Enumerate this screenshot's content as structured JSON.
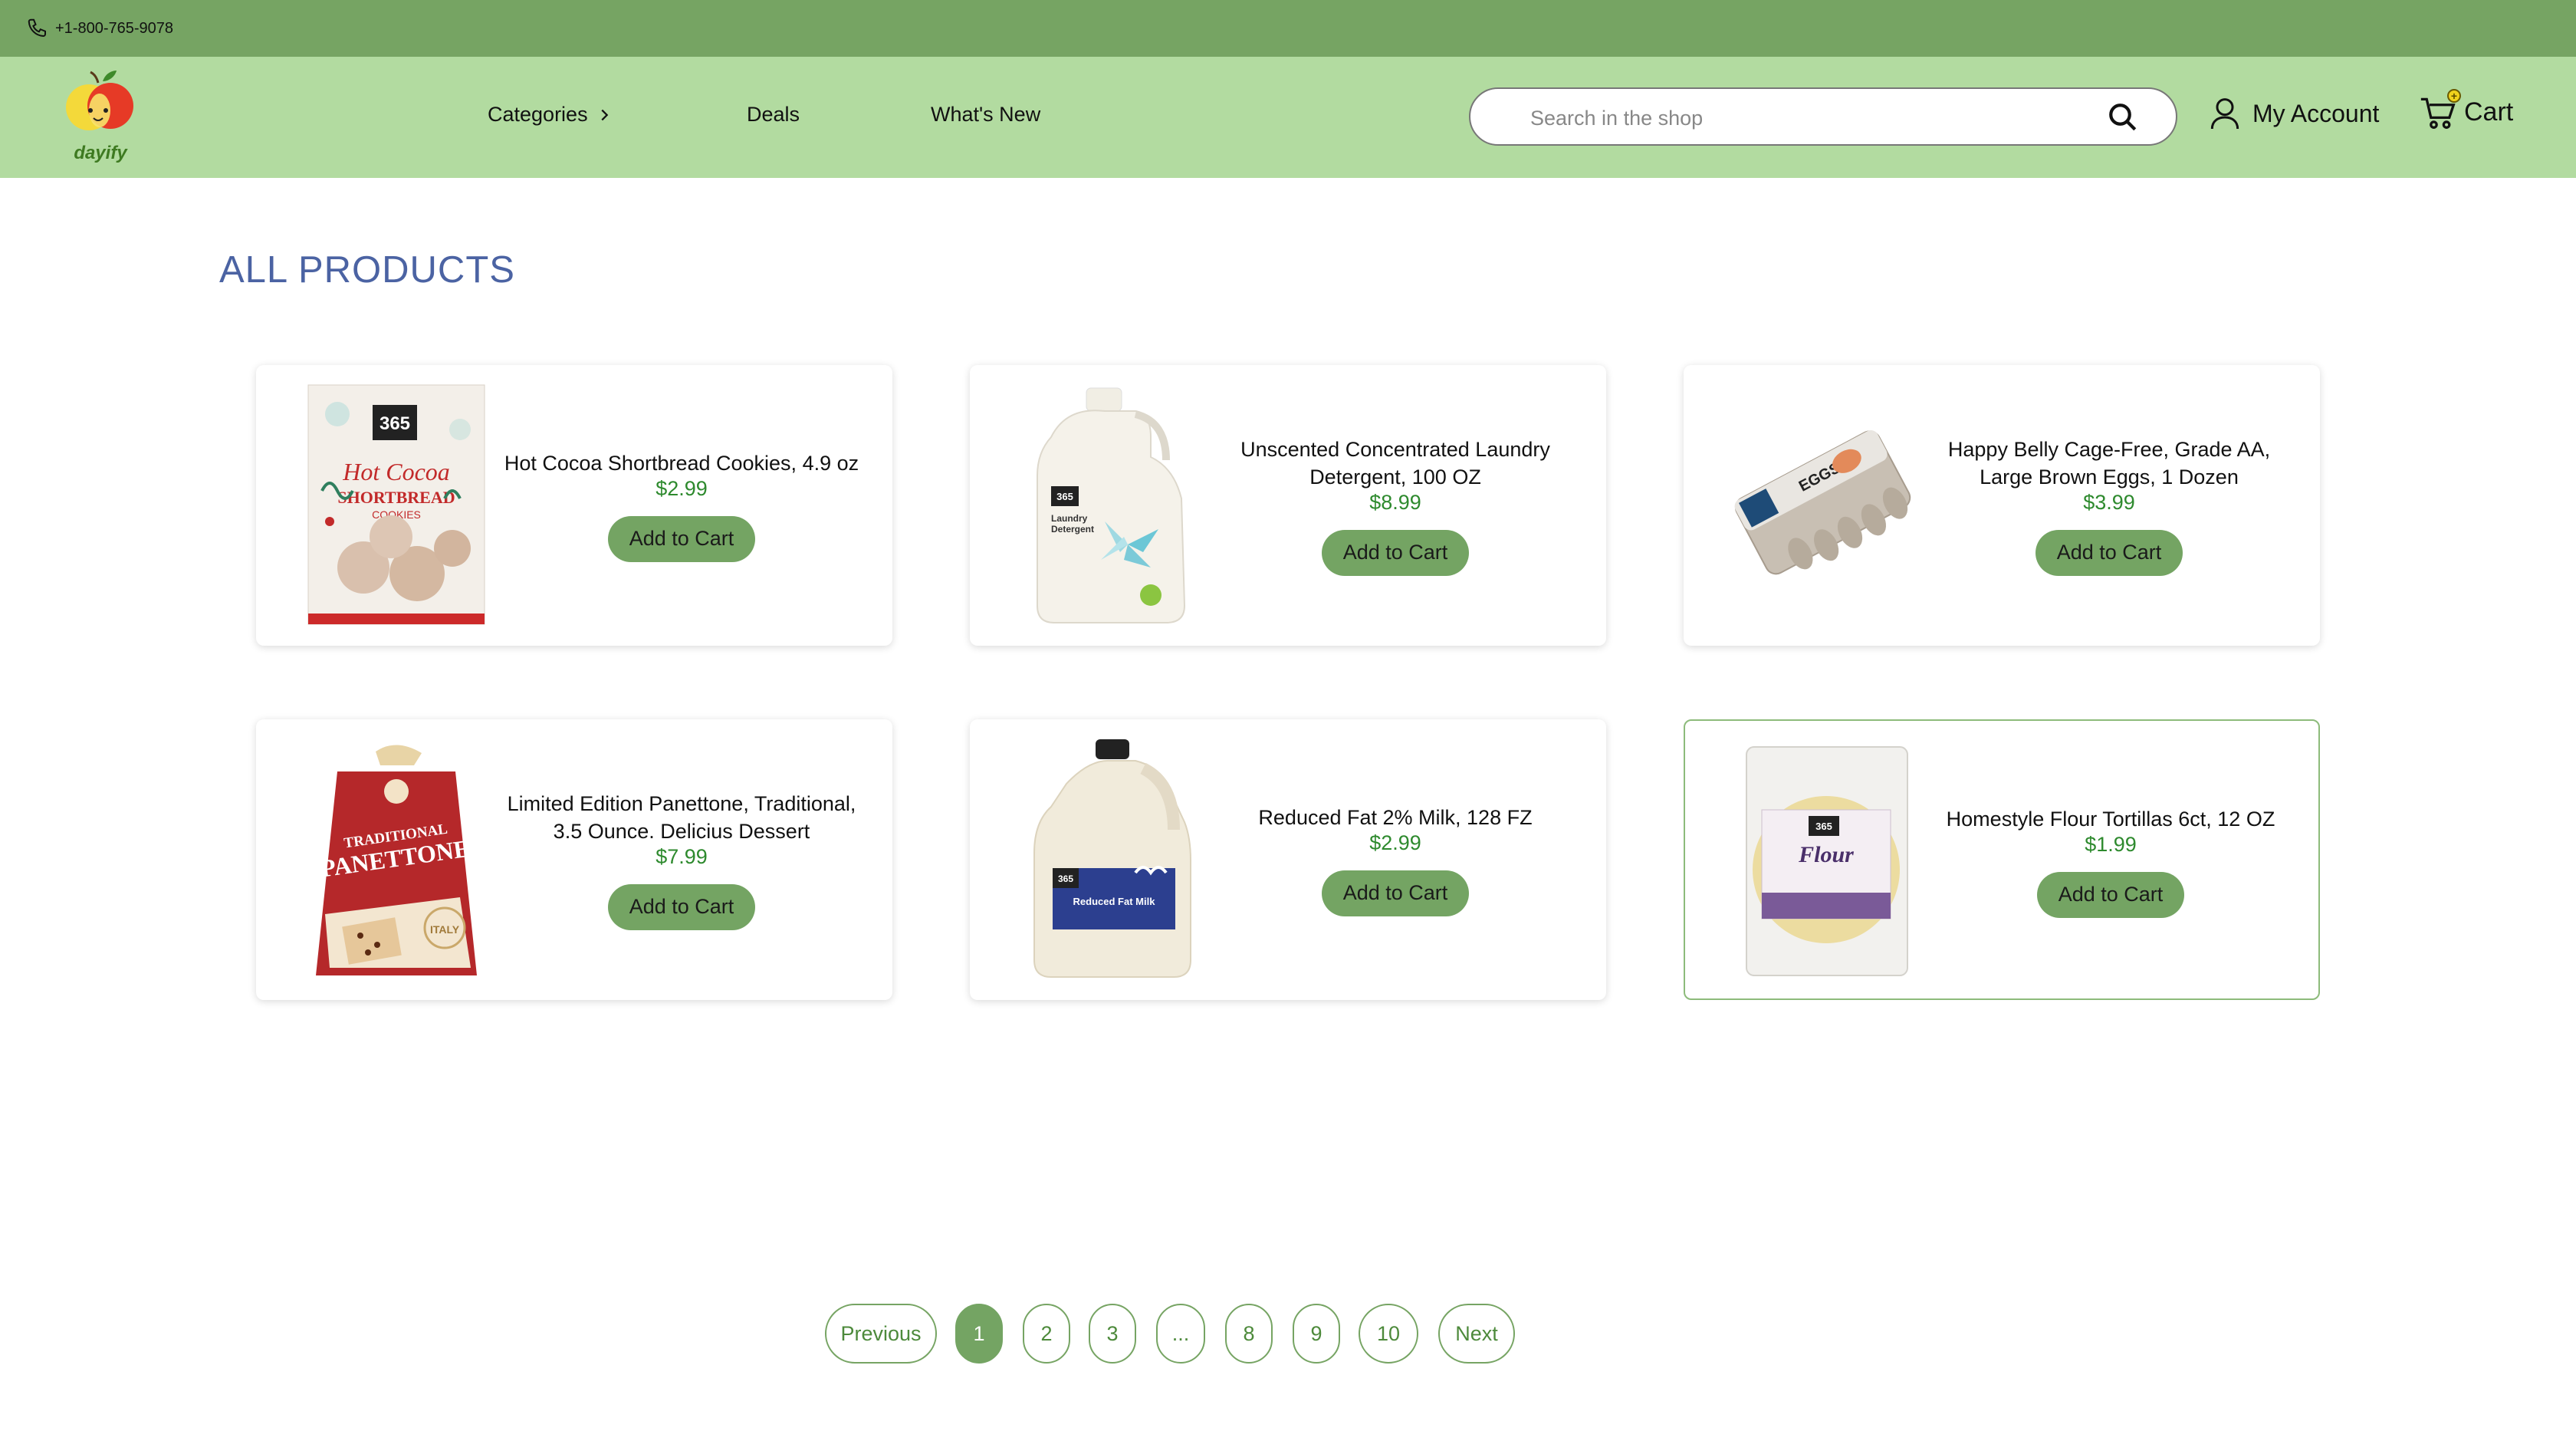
{
  "topbar": {
    "phone": "+1-800-765-9078",
    "phone_icon": "phone-icon"
  },
  "header": {
    "logo_text": "dayify",
    "nav": {
      "categories": "Categories",
      "deals": "Deals",
      "whats_new": "What's New"
    },
    "search": {
      "placeholder": "Search in the shop",
      "value": ""
    },
    "account": "My Account",
    "cart": "Cart"
  },
  "colors": {
    "topbar": "#76a463",
    "header": "#b2dba0",
    "accent": "#74a463",
    "price": "#2e8a2e",
    "title": "#4b63a3"
  },
  "main": {
    "title": "ALL PRODUCTS",
    "add_to_cart": "Add to Cart",
    "products": [
      {
        "name": "Hot Cocoa Shortbread Cookies, 4.9 oz",
        "price": "$2.99",
        "image": "cookies-box-image"
      },
      {
        "name": "Unscented Concentrated Laundry Detergent, 100 OZ",
        "price": "$8.99",
        "image": "detergent-jug-image"
      },
      {
        "name": "Happy Belly Cage-Free, Grade AA, Large Brown Eggs, 1 Dozen",
        "price": "$3.99",
        "image": "egg-carton-image"
      },
      {
        "name": "Limited Edition Panettone, Traditional, 3.5 Ounce. Delicius Dessert",
        "price": "$7.99",
        "image": "panettone-box-image"
      },
      {
        "name": "Reduced Fat 2% Milk, 128 FZ",
        "price": "$2.99",
        "image": "milk-jug-image"
      },
      {
        "name": "Homestyle Flour Tortillas 6ct, 12 OZ",
        "price": "$1.99",
        "image": "tortilla-pack-image"
      }
    ],
    "product_image_text": {
      "cookies": {
        "brand": "365",
        "line1": "Hot Cocoa",
        "line2": "SHORTBREAD",
        "line3": "COOKIES"
      },
      "detergent": {
        "brand": "365",
        "line1": "Laundry",
        "line2": "Detergent"
      },
      "eggs": {
        "label": "EGGS"
      },
      "panettone": {
        "line1": "TRADITIONAL",
        "line2": "PANETTONE",
        "badge": "ITALY"
      },
      "milk": {
        "brand": "365",
        "line1": "Reduced Fat Milk"
      },
      "tortillas": {
        "brand": "365",
        "line1": "Flour"
      }
    }
  },
  "pagination": {
    "previous": "Previous",
    "next": "Next",
    "pages": [
      "1",
      "2",
      "3",
      "...",
      "8",
      "9",
      "10"
    ],
    "current": "1"
  }
}
